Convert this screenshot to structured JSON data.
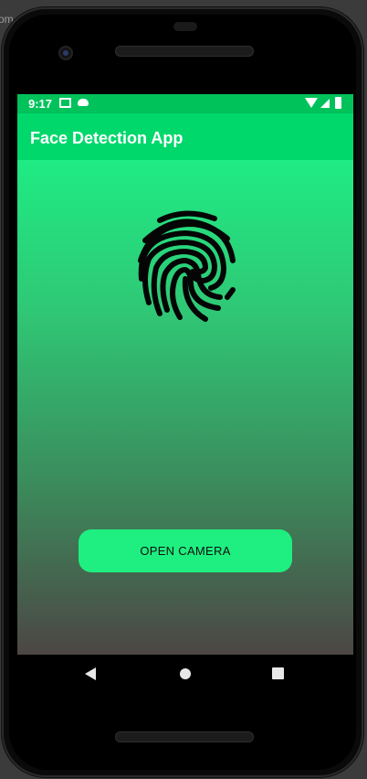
{
  "background_fragment": "om",
  "status_bar": {
    "time": "9:17",
    "icons": [
      "mail-icon",
      "cloud-icon",
      "wifi-icon",
      "signal-icon",
      "battery-icon"
    ],
    "color": "#00c25b"
  },
  "app_bar": {
    "title": "Face Detection App",
    "color": "#00d86c"
  },
  "main": {
    "image_icon": "fingerprint-icon",
    "open_camera_label": "OPEN CAMERA",
    "button_color": "#1eef80",
    "gradient_colors": [
      "#1feb83",
      "#2fc876",
      "#3b8c5c",
      "#4c4644"
    ]
  },
  "nav_bar": {
    "buttons": [
      "back-icon",
      "home-icon",
      "recents-icon"
    ]
  }
}
